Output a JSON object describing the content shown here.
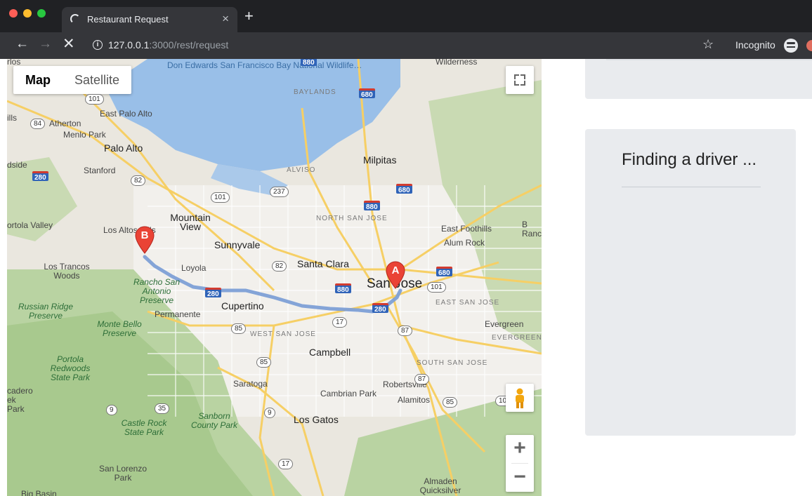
{
  "browser": {
    "tab_title": "Restaurant Request",
    "tab_close": "×",
    "new_tab": "+",
    "url_host": "127.0.0.1",
    "url_path": ":3000/rest/request",
    "incognito_label": "Incognito",
    "icons": {
      "back": "arrow-left-icon",
      "forward": "arrow-right-icon",
      "stop": "close-icon",
      "info": "info-icon",
      "bookmark": "star-icon",
      "incognito": "incognito-icon"
    }
  },
  "map": {
    "type_controls": [
      "Map",
      "Satellite"
    ],
    "zoom_in": "+",
    "zoom_out": "−",
    "markers": {
      "origin": "A",
      "destination": "B"
    },
    "route_color": "#7d9fd6",
    "labels": {
      "don_edwards": "Don Edwards San Francisco Bay National Wildlife…",
      "east_palo_alto": "East Palo Alto",
      "atherton": "Atherton",
      "menlo_park": "Menlo Park",
      "palo_alto": "Palo Alto",
      "stanford": "Stanford",
      "ortola_valley": "ortola Valley",
      "los_altos": "Los Altos Hills",
      "mountain_view": "Mountain View",
      "sunnyvale": "Sunnyvale",
      "los_trancos": "Los Trancos Woods",
      "loyola": "Loyola",
      "rancho_san_antonio": "Rancho San Antonio Preserve",
      "permanente": "Permanente",
      "cupertino": "Cupertino",
      "russian_ridge": "Russian Ridge Preserve",
      "monte_bello": "Monte Bello Preserve",
      "santa_clara": "Santa Clara",
      "san_jose": "San Jose",
      "milpitas": "Milpitas",
      "alviso": "ALVISO",
      "baylands": "BAYLANDS",
      "north_san_jose": "NORTH SAN JOSE",
      "east_foothills": "East Foothills",
      "alum_rock": "Alum Rock",
      "east_san_jose": "EAST SAN JOSE",
      "evergreen": "Evergreen",
      "evergreen_caps": "EVERGREEN",
      "west_san_jose": "WEST SAN JOSE",
      "campbell": "Campbell",
      "south_san_jose": "SOUTH SAN JOSE",
      "saratoga": "Saratoga",
      "cambrian_park": "Cambrian Park",
      "robertsville": "Robertsville",
      "alamitos": "Alamitos",
      "los_gatos": "Los Gatos",
      "castle_rock": "Castle Rock State Park",
      "sanborn": "Sanborn County Park",
      "portola": "Portola Redwoods State Park",
      "cadero": "cadero ek Park",
      "san_lorenzo": "San Lorenzo Park",
      "almaden": "Almaden Quicksilver",
      "wilderness": "Wilderness",
      "rlos": "rlos",
      "ills": "ills",
      "dside": "dside",
      "ranc": "B Ranc",
      "big_basin": "Big Basin"
    },
    "shields": [
      "880",
      "680",
      "680",
      "880",
      "280",
      "280",
      "880",
      "280",
      "680"
    ],
    "route_shields": [
      "101",
      "84",
      "82",
      "237",
      "101",
      "82",
      "101",
      "17",
      "85",
      "87",
      "85",
      "87",
      "85",
      "9",
      "35",
      "9",
      "17",
      "101"
    ]
  },
  "panel": {
    "status_title": "Finding a driver ..."
  }
}
